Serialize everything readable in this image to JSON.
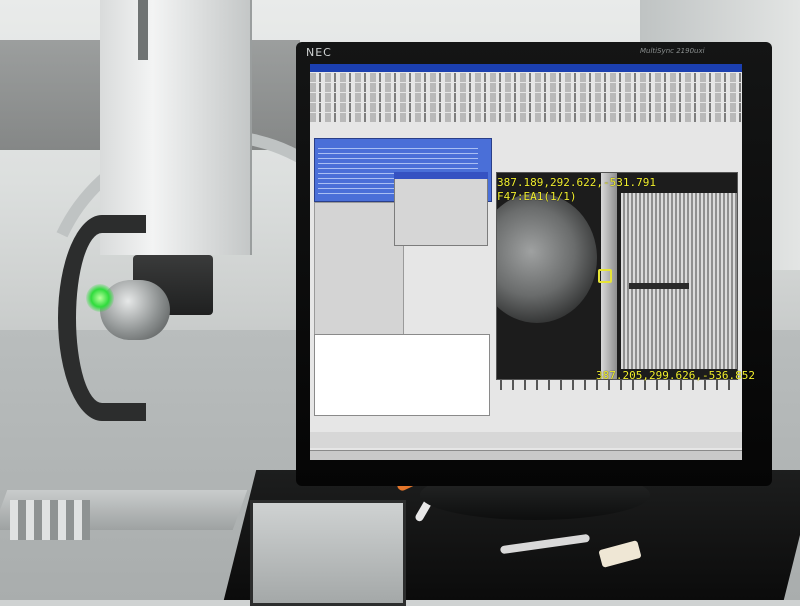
{
  "monitor": {
    "brand": "NEC",
    "model": "MultiSync 2190uxi"
  },
  "camera_overlay": {
    "coords_top": "387.189,292.622,-531.791",
    "feature_label": "F47:EA1(1/1)",
    "coords_bottom": "387.205,299.626,-536.852"
  },
  "colors": {
    "overlay_text": "#f1ef2e",
    "window_title": "#1b3fb0",
    "probe_led": "#2fdc3c"
  }
}
